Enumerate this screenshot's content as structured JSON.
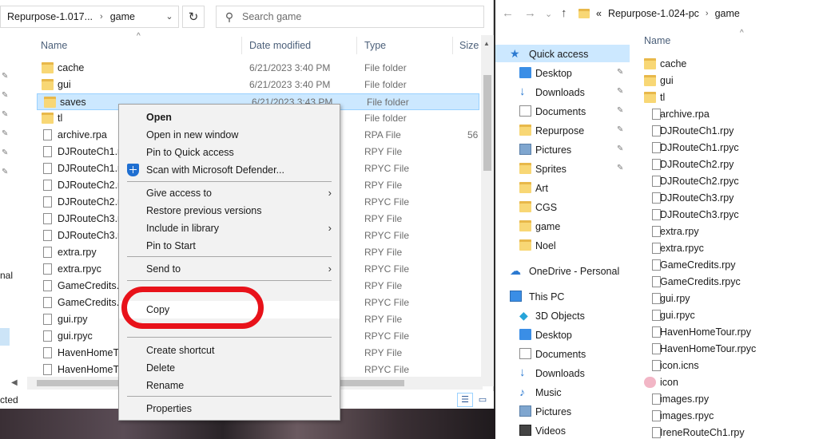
{
  "left_window": {
    "address": {
      "path": "Repurpose-1.017...",
      "current": "game"
    },
    "search_placeholder": "Search game",
    "columns": {
      "name": "Name",
      "date": "Date modified",
      "type": "Type",
      "size": "Size"
    },
    "nav_fragments": {
      "nal": "nal",
      "cted": "cted"
    },
    "rows": [
      {
        "name": "cache",
        "date": "6/21/2023 3:40 PM",
        "type": "File folder",
        "size": "",
        "kind": "folder"
      },
      {
        "name": "gui",
        "date": "6/21/2023 3:40 PM",
        "type": "File folder",
        "size": "",
        "kind": "folder"
      },
      {
        "name": "saves",
        "date": "6/21/2023 3:43 PM",
        "type": "File folder",
        "size": "",
        "kind": "folder",
        "selected": true
      },
      {
        "name": "tl",
        "date": "",
        "type": "File folder",
        "size": "",
        "kind": "folder"
      },
      {
        "name": "archive.rpa",
        "date": "",
        "type": "RPA File",
        "size": "56",
        "kind": "file"
      },
      {
        "name": "DJRouteCh1.rp",
        "date": "",
        "type": "RPY File",
        "size": "",
        "kind": "file"
      },
      {
        "name": "DJRouteCh1.rp",
        "date": "",
        "type": "RPYC File",
        "size": "",
        "kind": "file"
      },
      {
        "name": "DJRouteCh2.rp",
        "date": "",
        "type": "RPY File",
        "size": "",
        "kind": "file"
      },
      {
        "name": "DJRouteCh2.rp",
        "date": "",
        "type": "RPYC File",
        "size": "",
        "kind": "file"
      },
      {
        "name": "DJRouteCh3.rp",
        "date": "",
        "type": "RPY File",
        "size": "",
        "kind": "file"
      },
      {
        "name": "DJRouteCh3.rp",
        "date": "",
        "type": "RPYC File",
        "size": "",
        "kind": "file"
      },
      {
        "name": "extra.rpy",
        "date": "",
        "type": "RPY File",
        "size": "",
        "kind": "file"
      },
      {
        "name": "extra.rpyc",
        "date": "",
        "type": "RPYC File",
        "size": "",
        "kind": "file"
      },
      {
        "name": "GameCredits.r",
        "date": "",
        "type": "RPY File",
        "size": "",
        "kind": "file"
      },
      {
        "name": "GameCredits.r",
        "date": "",
        "type": "RPYC File",
        "size": "",
        "kind": "file"
      },
      {
        "name": "gui.rpy",
        "date": "",
        "type": "RPY File",
        "size": "",
        "kind": "file"
      },
      {
        "name": "gui.rpyc",
        "date": "",
        "type": "RPYC File",
        "size": "",
        "kind": "file"
      },
      {
        "name": "HavenHomeTo",
        "date": "",
        "type": "RPY File",
        "size": "",
        "kind": "file"
      },
      {
        "name": "HavenHomeTo",
        "date": "",
        "type": "RPYC File",
        "size": "",
        "kind": "file"
      }
    ]
  },
  "context_menu": {
    "open": "Open",
    "open_new_window": "Open in new window",
    "pin_quick_access": "Pin to Quick access",
    "scan_defender": "Scan with Microsoft Defender...",
    "give_access": "Give access to",
    "restore_versions": "Restore previous versions",
    "include_library": "Include in library",
    "pin_start": "Pin to Start",
    "send_to": "Send to",
    "copy": "Copy",
    "create_shortcut": "Create shortcut",
    "delete": "Delete",
    "rename": "Rename",
    "properties": "Properties",
    "submenu_arrow": "›"
  },
  "right_window": {
    "address": {
      "prefix": "«",
      "path": "Repurpose-1.024-pc",
      "current": "game"
    },
    "sidebar": [
      {
        "label": "Quick access",
        "icon": "star-icon",
        "selected": true,
        "top": true
      },
      {
        "label": "Desktop",
        "icon": "desktop-icon",
        "pinned": true
      },
      {
        "label": "Downloads",
        "icon": "download-icon",
        "pinned": true
      },
      {
        "label": "Documents",
        "icon": "document-icon",
        "pinned": true
      },
      {
        "label": "Repurpose",
        "icon": "folder-icon",
        "pinned": true
      },
      {
        "label": "Pictures",
        "icon": "pictures-icon",
        "pinned": true
      },
      {
        "label": "Sprites",
        "icon": "folder-icon",
        "pinned": true
      },
      {
        "label": "Art",
        "icon": "folder-icon"
      },
      {
        "label": "CGS",
        "icon": "folder-icon"
      },
      {
        "label": "game",
        "icon": "folder-icon"
      },
      {
        "label": "Noel",
        "icon": "folder-icon"
      },
      {
        "label": "OneDrive - Personal",
        "icon": "cloud-icon",
        "top": true
      },
      {
        "label": "This PC",
        "icon": "pc-icon",
        "top": true
      },
      {
        "label": "3D Objects",
        "icon": "cube-icon"
      },
      {
        "label": "Desktop",
        "icon": "desktop-icon"
      },
      {
        "label": "Documents",
        "icon": "document-icon"
      },
      {
        "label": "Downloads",
        "icon": "download-icon"
      },
      {
        "label": "Music",
        "icon": "music-icon"
      },
      {
        "label": "Pictures",
        "icon": "pictures-icon"
      },
      {
        "label": "Videos",
        "icon": "video-icon"
      }
    ],
    "column_name": "Name",
    "files": [
      {
        "name": "cache",
        "kind": "folder"
      },
      {
        "name": "gui",
        "kind": "folder"
      },
      {
        "name": "tl",
        "kind": "folder"
      },
      {
        "name": "archive.rpa",
        "kind": "file"
      },
      {
        "name": "DJRouteCh1.rpy",
        "kind": "file"
      },
      {
        "name": "DJRouteCh1.rpyc",
        "kind": "file"
      },
      {
        "name": "DJRouteCh2.rpy",
        "kind": "file"
      },
      {
        "name": "DJRouteCh2.rpyc",
        "kind": "file"
      },
      {
        "name": "DJRouteCh3.rpy",
        "kind": "file"
      },
      {
        "name": "DJRouteCh3.rpyc",
        "kind": "file"
      },
      {
        "name": "extra.rpy",
        "kind": "file"
      },
      {
        "name": "extra.rpyc",
        "kind": "file"
      },
      {
        "name": "GameCredits.rpy",
        "kind": "file"
      },
      {
        "name": "GameCredits.rpyc",
        "kind": "file"
      },
      {
        "name": "gui.rpy",
        "kind": "file"
      },
      {
        "name": "gui.rpyc",
        "kind": "file"
      },
      {
        "name": "HavenHomeTour.rpy",
        "kind": "file"
      },
      {
        "name": "HavenHomeTour.rpyc",
        "kind": "file"
      },
      {
        "name": "icon.icns",
        "kind": "file"
      },
      {
        "name": "icon",
        "kind": "image"
      },
      {
        "name": "images.rpy",
        "kind": "file"
      },
      {
        "name": "images.rpyc",
        "kind": "file"
      },
      {
        "name": "IreneRouteCh1.rpy",
        "kind": "file"
      }
    ]
  },
  "colors": {
    "selection": "#cce8ff",
    "highlight_oval": "#e8121a",
    "folder": "#f8d775",
    "accent": "#2b79d0"
  }
}
